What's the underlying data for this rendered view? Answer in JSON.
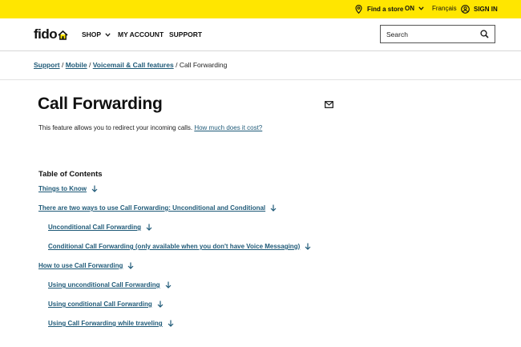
{
  "topbar": {
    "find_store": "Find a store",
    "province": "ON",
    "language": "Français",
    "sign_in": "SIGN IN"
  },
  "header": {
    "logo": "fido",
    "nav": {
      "shop": "SHOP",
      "my_account": "MY ACCOUNT",
      "support": "SUPPORT"
    },
    "search": {
      "placeholder": "Search"
    }
  },
  "breadcrumb": {
    "items": [
      "Support",
      "Mobile",
      "Voicemail & Call features"
    ],
    "current": "Call Forwarding",
    "separator": "/"
  },
  "page": {
    "title": "Call Forwarding",
    "intro": "This feature allows you to redirect your incoming calls.",
    "intro_link": "How much does it cost?"
  },
  "toc": {
    "heading": "Table of Contents",
    "items": [
      {
        "label": "Things to Know",
        "level": 0
      },
      {
        "label": "There are two ways to use Call Forwarding: Unconditional and Conditional",
        "level": 0
      },
      {
        "label": "Unconditional Call Forwarding",
        "level": 1
      },
      {
        "label": "Conditional Call Forwarding (only available when you don't have Voice Messaging)",
        "level": 1
      },
      {
        "label": "How to use Call Forwarding",
        "level": 0
      },
      {
        "label": "Using unconditional Call Forwarding",
        "level": 1
      },
      {
        "label": "Using conditional Call Forwarding",
        "level": 1
      },
      {
        "label": "Using Call Forwarding while traveling",
        "level": 1
      }
    ]
  },
  "colors": {
    "brand_yellow": "#ffe600",
    "link": "#1f5a78",
    "text": "#111111"
  }
}
